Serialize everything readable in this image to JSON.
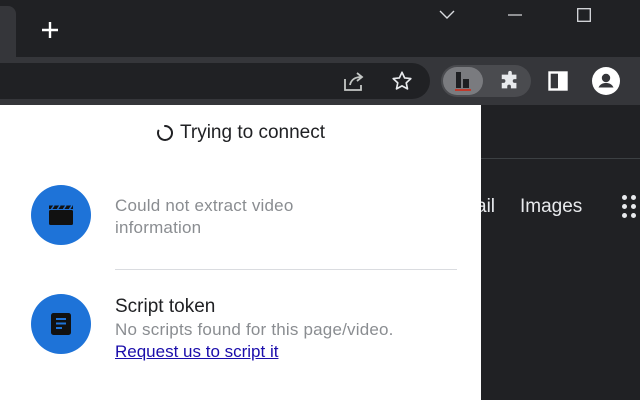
{
  "popup": {
    "status_text": "Trying to connect",
    "video_item": {
      "message": "Could not extract video information",
      "icon": "clapperboard-icon"
    },
    "script_item": {
      "title": "Script token",
      "message": "No scripts found for this page/video.",
      "link": "Request us to script it",
      "icon": "document-icon"
    },
    "accent_color": "#1e73d8"
  },
  "page": {
    "gmail_fragment": "ail",
    "images_link": "Images"
  },
  "toolbar": {
    "icons": [
      "share-icon",
      "bookmark-star-icon",
      "extension-active-icon",
      "puzzle-extensions-icon",
      "side-panel-icon",
      "profile-icon"
    ]
  },
  "window": {
    "controls": [
      "tab-search-chevron-icon",
      "minimize-icon",
      "maximize-icon"
    ]
  }
}
